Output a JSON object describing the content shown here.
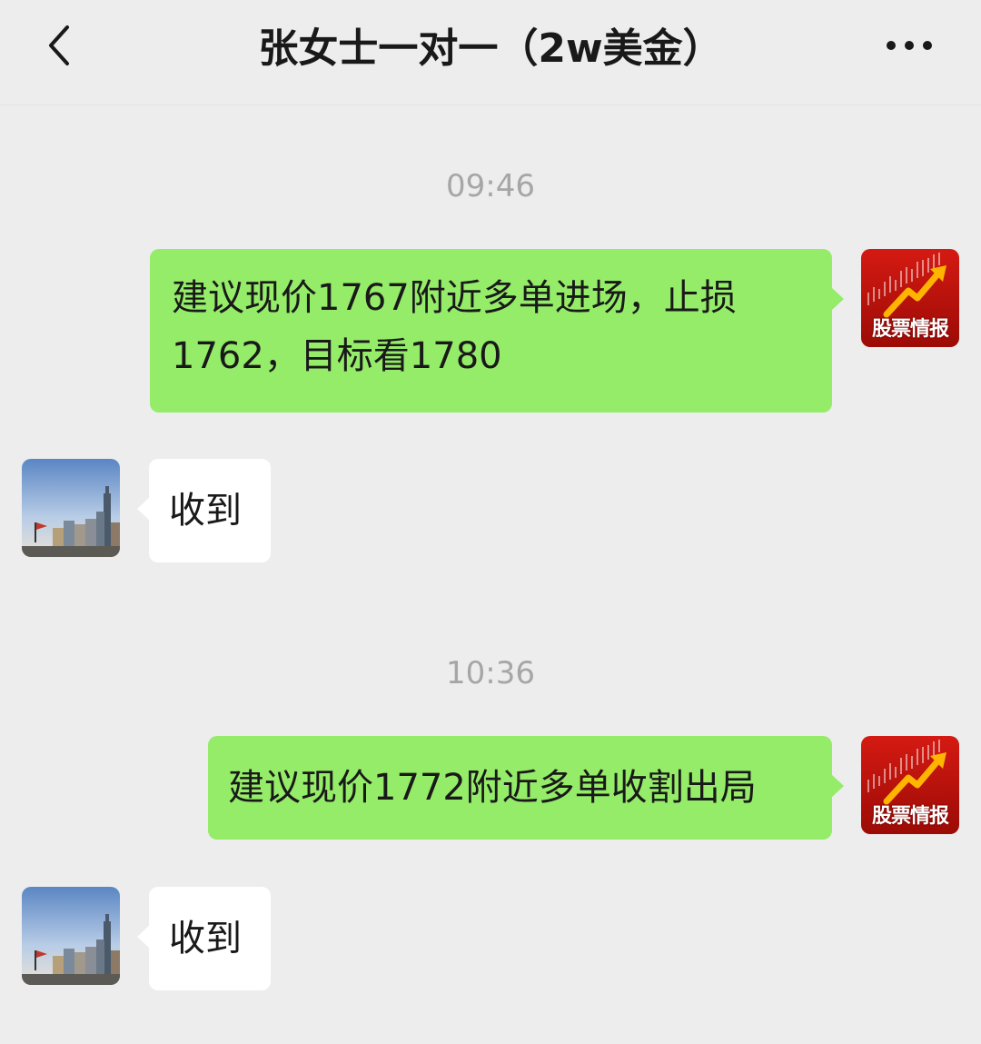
{
  "header": {
    "title": "张女士一对一（2w美金）"
  },
  "messages": [
    {
      "type": "time",
      "text": "09:46"
    },
    {
      "type": "outgoing",
      "text": "建议现价1767附近多单进场，止损1762，目标看1780",
      "avatar_text": "股票情报"
    },
    {
      "type": "incoming",
      "text": "收到"
    },
    {
      "type": "time",
      "text": "10:36"
    },
    {
      "type": "outgoing",
      "text": "建议现价1772附近多单收割出局",
      "avatar_text": "股票情报"
    },
    {
      "type": "incoming",
      "text": "收到"
    }
  ],
  "colors": {
    "background": "#ededed",
    "outgoing_bubble": "#95ec69",
    "incoming_bubble": "#ffffff",
    "time_text": "#a6a6a6",
    "title_text": "#191919"
  },
  "icons": {
    "back": "chevron-left-icon",
    "more": "more-dots-icon"
  }
}
